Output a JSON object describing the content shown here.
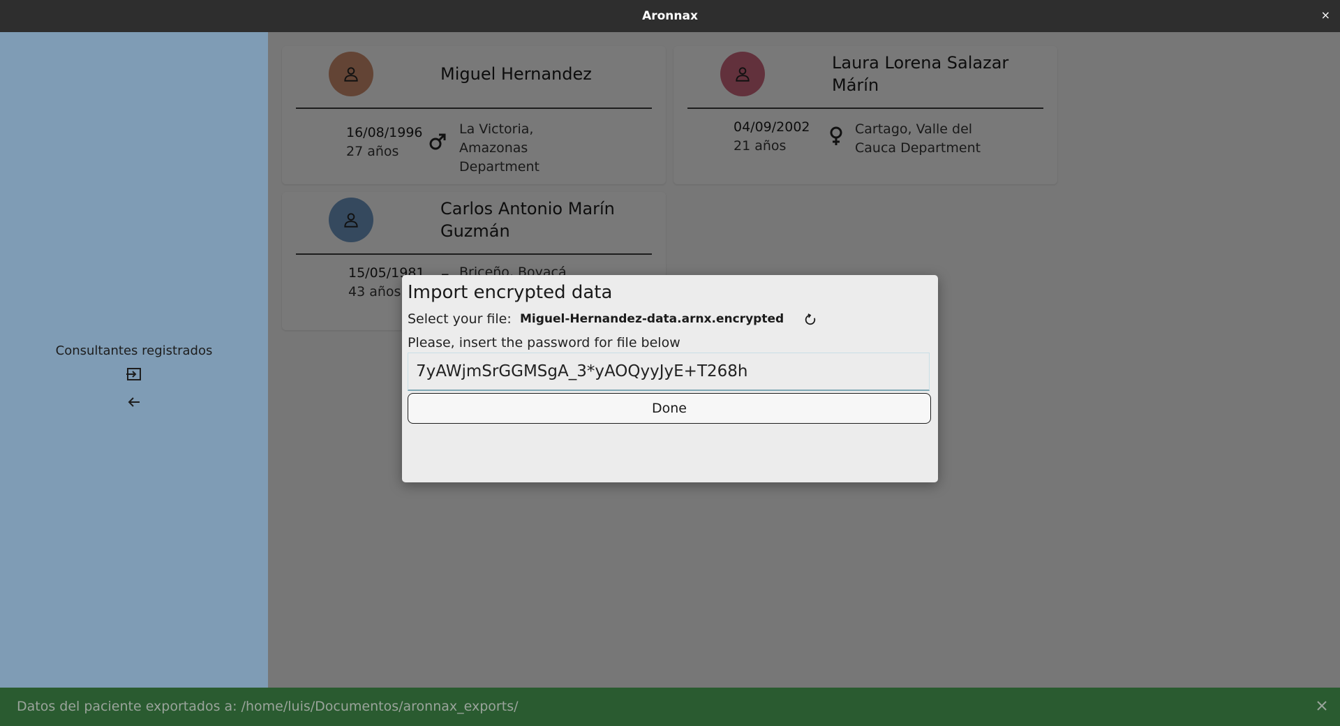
{
  "window": {
    "title": "Aronnax",
    "close_glyph": "×"
  },
  "sidebar": {
    "label": "Consultantes registrados",
    "icons": [
      "import-icon",
      "back-arrow-icon"
    ]
  },
  "patients": [
    {
      "name": "Miguel Hernandez",
      "dob": "16/08/1996",
      "age": "27 años",
      "gender": "male",
      "place": "La Victoria, Amazonas Department",
      "avatar_color": "#c7896a"
    },
    {
      "name": "Laura Lorena Salazar Márín",
      "dob": "04/09/2002",
      "age": "21 años",
      "gender": "female",
      "place": "Cartago, Valle del Cauca Department",
      "avatar_color": "#c46278"
    },
    {
      "name": "Carlos Antonio Marín Guzmán",
      "dob": "15/05/1981",
      "age": "43 años",
      "gender": "male",
      "place": "Briceño, Boyacá",
      "avatar_color": "#6a93bd"
    }
  ],
  "dialog": {
    "title": "Import encrypted data",
    "file_label": "Select your file:",
    "file_name": "Miguel-Hernandez-data.arnx.encrypted",
    "password_label": "Please, insert the password for file below",
    "password_value": "7yAWjmSrGGMSgA_3*yAOQyyJyE+T268h",
    "done_label": "Done"
  },
  "snackbar": {
    "message": "Datos del paciente exportados a: /home/luis/Documentos/aronnax_exports/",
    "color": "#2a5b30"
  },
  "colors": {
    "sidebar": "#7f9cb5",
    "titlebar": "#2e2e2e"
  }
}
